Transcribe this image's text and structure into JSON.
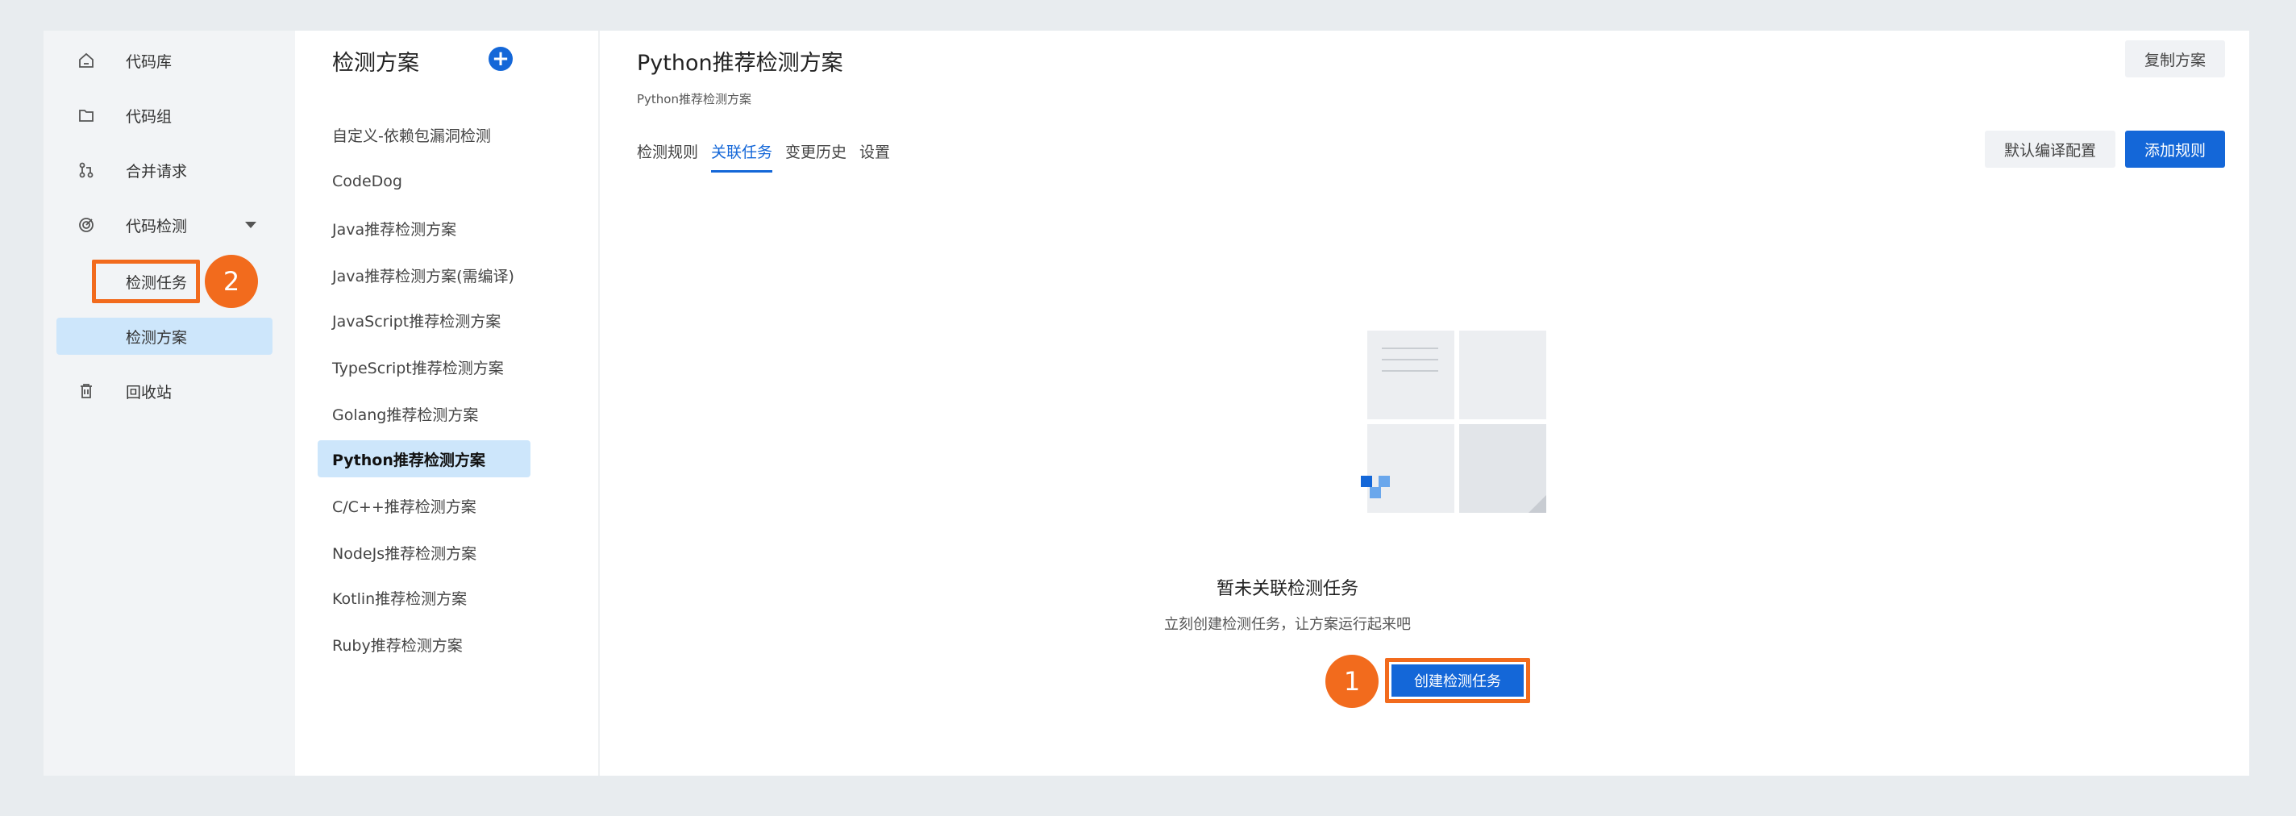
{
  "nav": {
    "items": [
      {
        "label": "代码库",
        "icon": "home-icon"
      },
      {
        "label": "代码组",
        "icon": "folder-icon"
      },
      {
        "label": "合并请求",
        "icon": "merge-request-icon"
      },
      {
        "label": "代码检测",
        "icon": "radar-icon"
      },
      {
        "label": "检测任务"
      },
      {
        "label": "检测方案"
      },
      {
        "label": "回收站",
        "icon": "trash-icon"
      }
    ],
    "marker_2": "2"
  },
  "schemes": {
    "title": "检测方案",
    "add_icon": "+",
    "items": [
      "自定义-依赖包漏洞检测",
      "CodeDog",
      "Java推荐检测方案",
      "Java推荐检测方案(需编译)",
      "JavaScript推荐检测方案",
      "TypeScript推荐检测方案",
      "Golang推荐检测方案",
      "Python推荐检测方案",
      "C/C++推荐检测方案",
      "NodeJs推荐检测方案",
      "Kotlin推荐检测方案",
      "Ruby推荐检测方案"
    ]
  },
  "main": {
    "title": "Python推荐检测方案",
    "subtitle": "Python推荐检测方案",
    "copy_button": "复制方案",
    "tabs": [
      "检测规则",
      "关联任务",
      "变更历史",
      "设置"
    ],
    "default_config_button": "默认编译配置",
    "add_rule_button": "添加规则",
    "empty": {
      "title": "暂未关联检测任务",
      "desc": "立刻创建检测任务，让方案运行起来吧",
      "create_button": "创建检测任务",
      "marker_1": "1"
    }
  },
  "colors": {
    "accent": "#1467d8",
    "highlight": "#f26b1d",
    "active_bg": "#cde6fb"
  }
}
